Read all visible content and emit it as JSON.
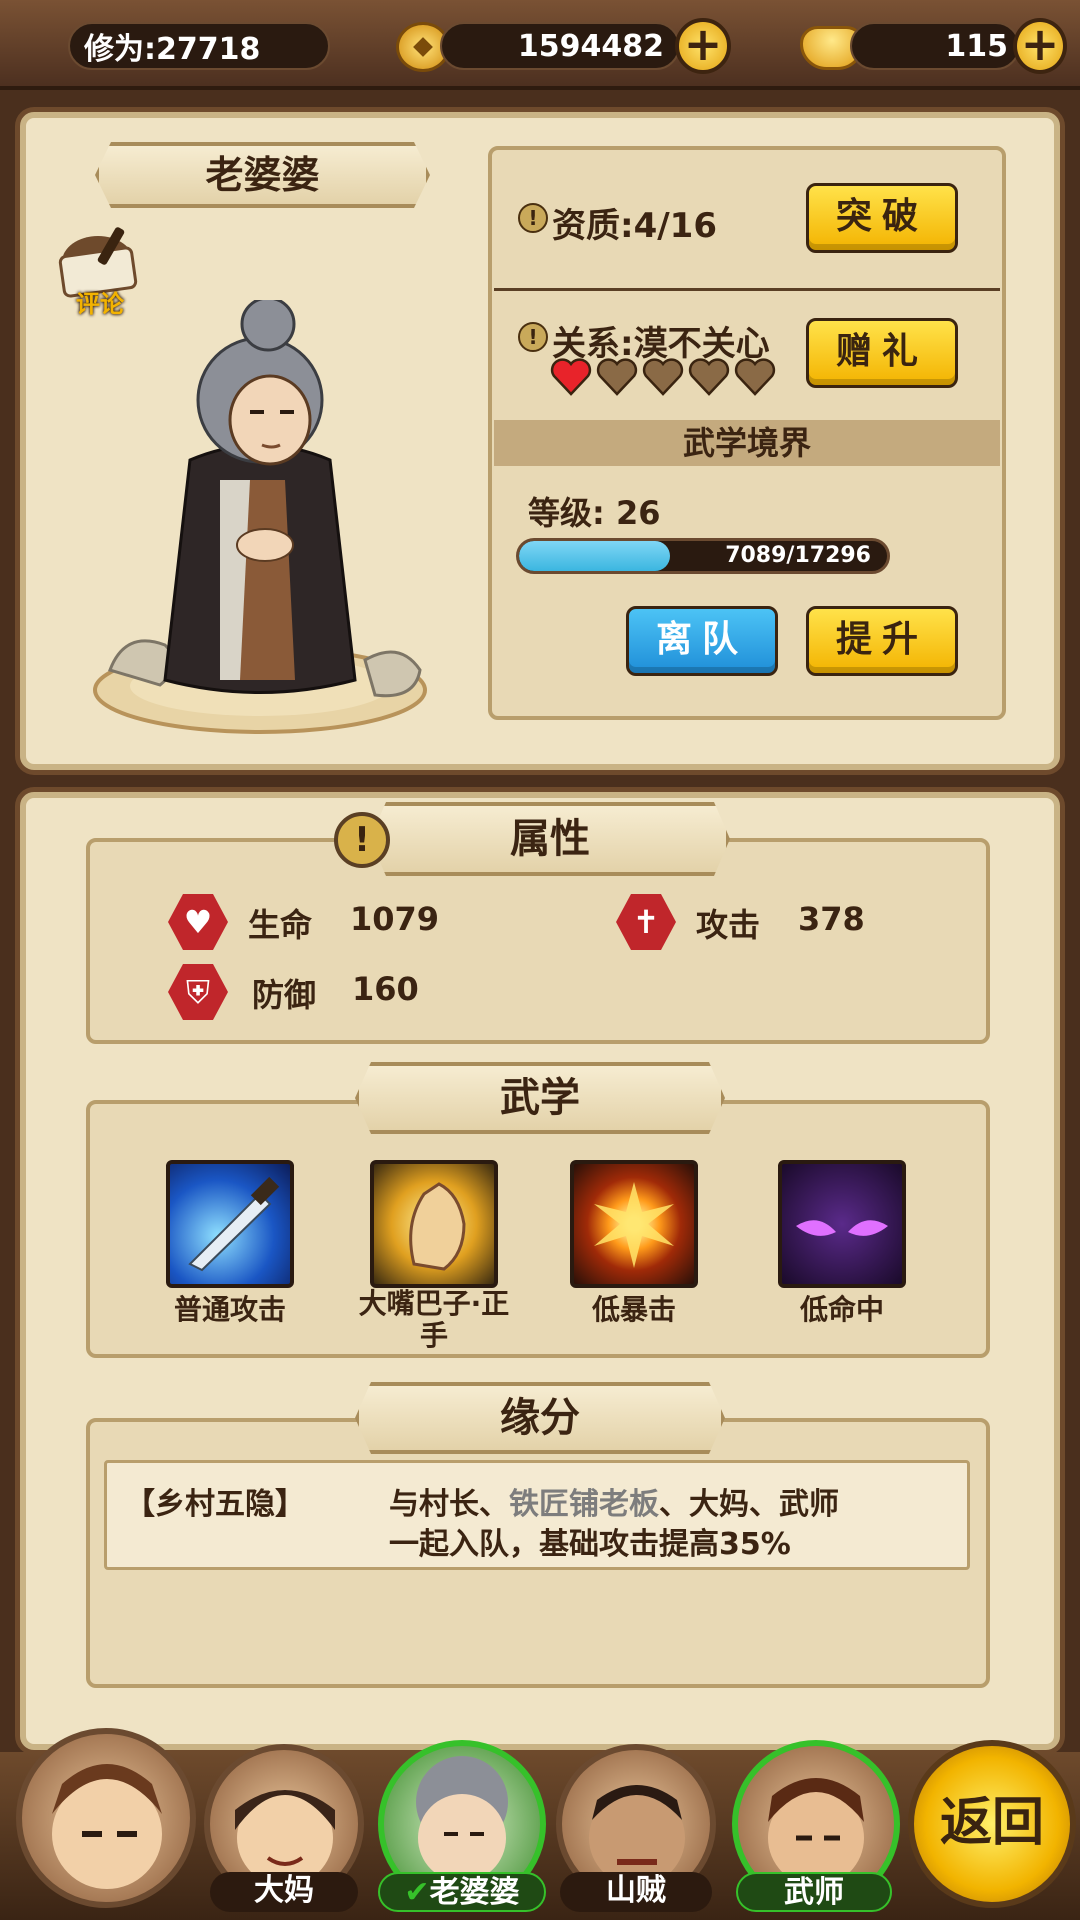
{
  "top": {
    "cultivation": "修为:27718",
    "coins": "1594482",
    "gold": "115",
    "plus_label": "+"
  },
  "hero": {
    "name": "老婆婆",
    "review_label": "评论",
    "aptitude": "资质:4/16",
    "breakthrough_label": "突破",
    "relation": "关系:漠不关心",
    "gift_label": "赠礼",
    "hearts_filled": 1,
    "hearts_total": 5,
    "martial_realm_title": "武学境界",
    "level_text": "等级:  26",
    "exp_text": "7089/17296",
    "exp_fraction": 0.41,
    "leave_label": "离队",
    "upgrade_label": "提升"
  },
  "attributes": {
    "title": "属性",
    "hp_label": "生命",
    "hp_value": "1079",
    "atk_label": "攻击",
    "atk_value": "378",
    "def_label": "防御",
    "def_value": "160"
  },
  "martial": {
    "title": "武学",
    "skills": [
      {
        "name": "普通攻击"
      },
      {
        "name": "大嘴巴子·正手"
      },
      {
        "name": "低暴击"
      },
      {
        "name": "低命中"
      }
    ]
  },
  "fate": {
    "title": "缘分",
    "tag": "【乡村五隐】",
    "desc_part1": "与村长、",
    "desc_highlight": "铁匠铺老板",
    "desc_part2": "、大妈、武师",
    "desc_line2": "一起入队，基础攻击提高35%"
  },
  "team": {
    "members": [
      {
        "name": ""
      },
      {
        "name": "大妈"
      },
      {
        "name": "老婆婆"
      },
      {
        "name": "山贼"
      },
      {
        "name": "武师"
      }
    ],
    "back_label": "返回"
  },
  "colors": {
    "accent_yellow": "#f3b300",
    "button_blue": "#1f8ed8",
    "exp_bar": "#3bb6e0",
    "selected_ring": "#36c12a",
    "highlight_text": "#7d7d7d"
  }
}
